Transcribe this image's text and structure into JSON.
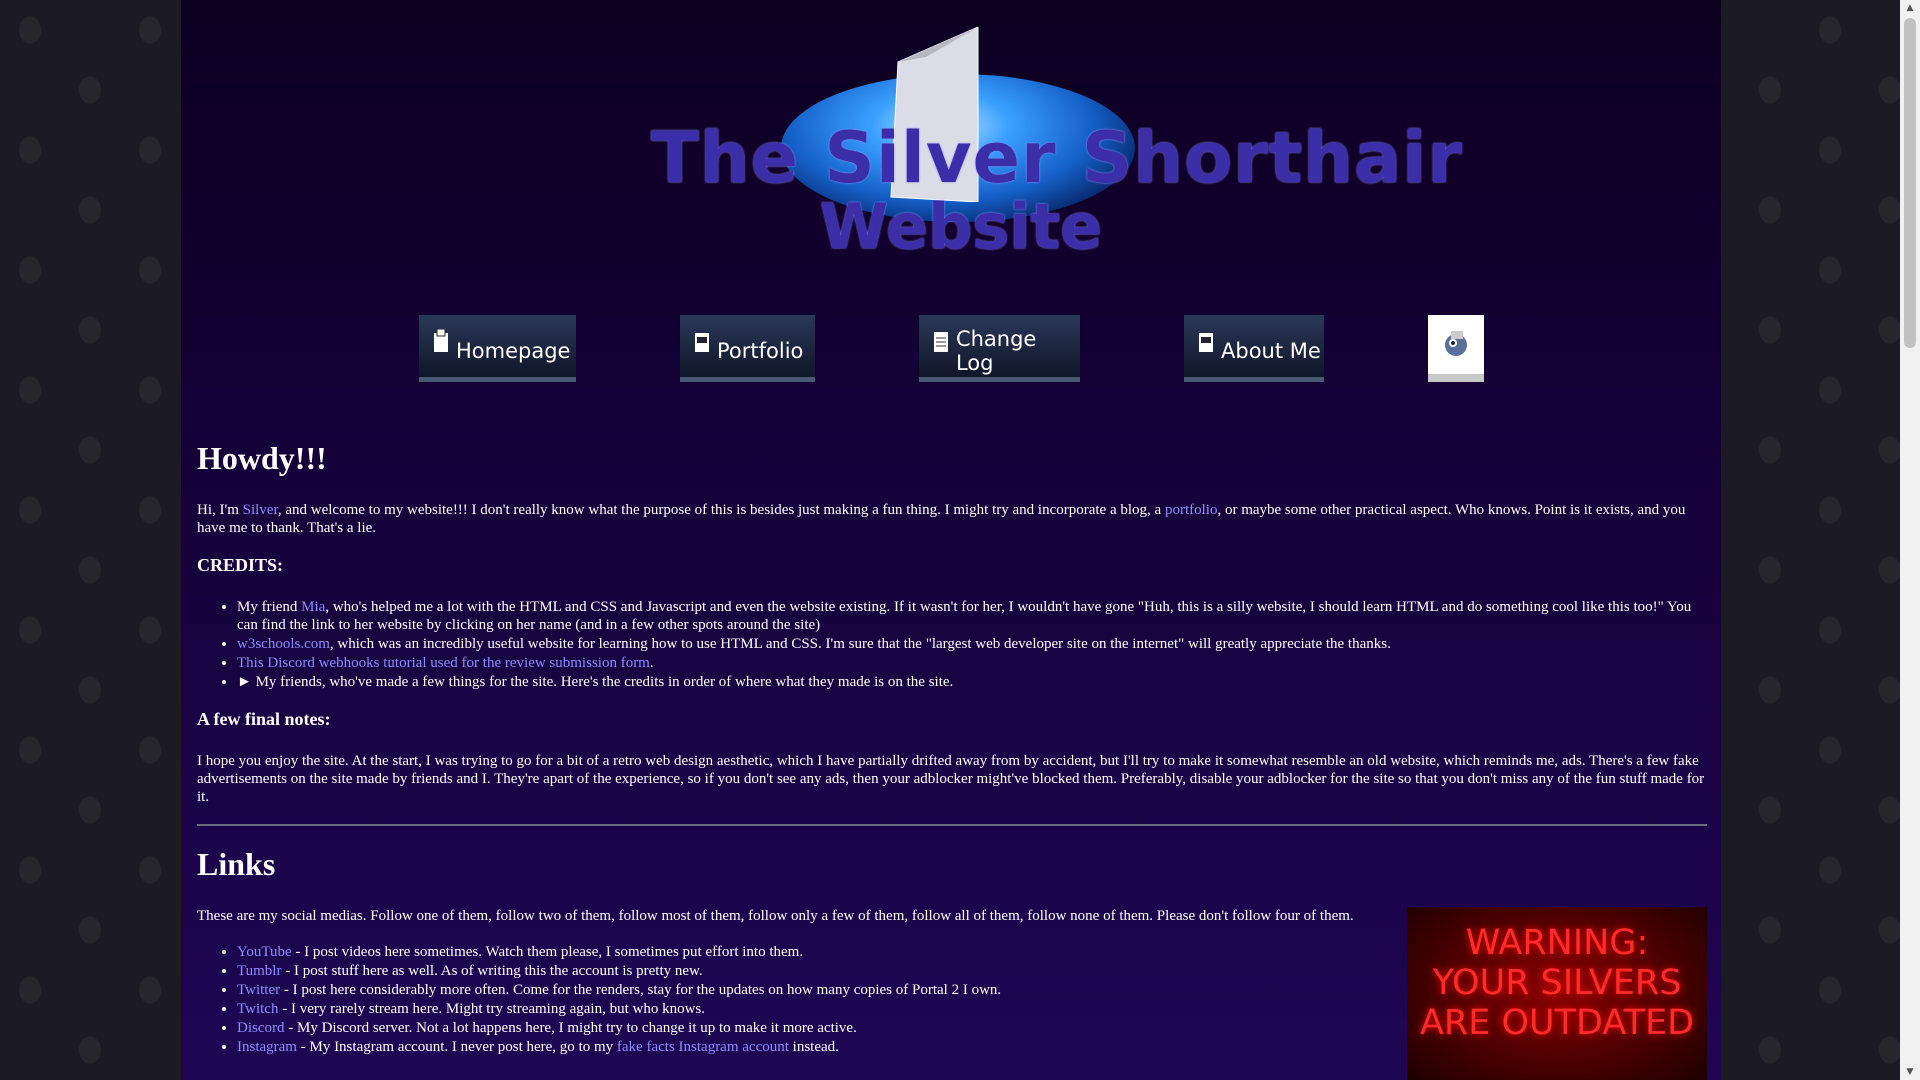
{
  "logo": {
    "line1": "The Silver Shorthair",
    "line2": "Website"
  },
  "nav": {
    "homepage": "Homepage",
    "portfolio": "Portfolio",
    "changelog": "Change Log",
    "about": "About Me"
  },
  "intro": {
    "heading": "Howdy!!!",
    "p_a": "Hi, I'm ",
    "silver_link": "Silver",
    "p_b": ", and welcome to my website!!! I don't really know what the purpose of this is besides just making a fun thing. I might try and incorporate a blog, a ",
    "portfolio_link": "portfolio",
    "p_c": ", or maybe some other practical aspect. Who knows. Point is it exists, and you have me to thank. That's a lie."
  },
  "credits": {
    "heading": "CREDITS:",
    "item1_a": "My friend ",
    "item1_link": "Mia",
    "item1_b": ", who's helped me a lot with the HTML and CSS and Javascript and even the website existing. If it wasn't for her, I wouldn't have gone \"Huh, this is a silly website, I should learn HTML and do something cool like this too!\" You can find the link to her website by clicking on her name (and in a few other spots around the site)",
    "item2_link": "w3schools.com",
    "item2_b": ", which was an incredibly useful website for learning how to use HTML and CSS. I'm sure that the \"largest web developer site on the internet\" will greatly appreciate the thanks.",
    "item3_link": "This Discord webhooks tutorial used for the review submission form",
    "item3_b": ".",
    "item4": "► My friends, who've made a few things for the site. Here's the credits in order of where what they made is on the site."
  },
  "notes": {
    "heading": "A few final notes:",
    "text": "I hope you enjoy the site. At the start, I was trying to go for a bit of a retro web design aesthetic, which I have partially drifted away from by accident, but I'll try to make it somewhat resemble an old website, which reminds me, ads. There's a few fake advertisements on the site made by friends and I. They're apart of the experience, so if you don't see any ads, then your adblocker might've blocked them. Preferably, disable your adblocker for the site so that you don't miss any of the fun stuff made for it."
  },
  "links": {
    "heading": "Links",
    "intro": "These are my social medias. Follow one of them, follow two of them, follow most of them, follow only a few of them, follow all of them, follow none of them. Please don't follow four of them.",
    "items": [
      {
        "name": "YouTube",
        "desc": " - I post videos here sometimes. Watch them please, I sometimes put effort into them."
      },
      {
        "name": "Tumblr",
        "desc": " - I post stuff here as well. As of writing this the account is pretty new."
      },
      {
        "name": "Twitter",
        "desc": " - I post here considerably more often. Come for the renders, stay for the updates on how many copies of Portal 2 I own."
      },
      {
        "name": "Twitch",
        "desc": " - I very rarely stream here. Might try streaming again, but who knows."
      },
      {
        "name": "Discord",
        "desc": " - My Discord server. Not a lot happens here, I might try to change it up to make it more active."
      },
      {
        "name": "Instagram",
        "desc": " - My Instagram account. I never post here, go to my "
      }
    ],
    "insta_link": "fake facts Instagram account",
    "insta_end": " instead."
  },
  "ad": {
    "line1": "WARNING:",
    "line2": "YOUR SILVERS",
    "line3": "ARE OUTDATED"
  },
  "colors": {
    "link": "#8f8cff",
    "background": "#140036",
    "warning": "#ff2a2a"
  }
}
